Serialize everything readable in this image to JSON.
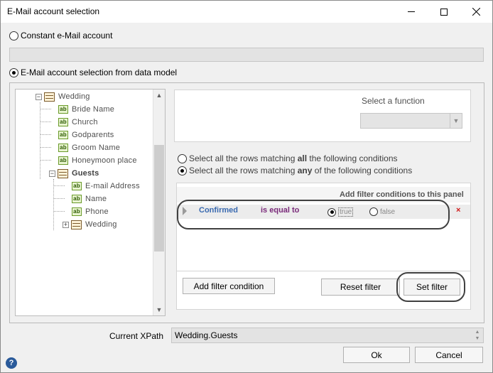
{
  "window": {
    "title": "E-Mail account selection"
  },
  "options": {
    "constant_label": "Constant e-Mail account",
    "constant_checked": false,
    "from_model_label": "E-Mail account selection from data model",
    "from_model_checked": true
  },
  "tree": {
    "items": [
      {
        "label": "Wedding",
        "kind": "table",
        "icon": "table-icon",
        "expander": "minus"
      },
      {
        "label": "Bride Name",
        "kind": "field",
        "icon": "ab-field-icon"
      },
      {
        "label": "Church",
        "kind": "field",
        "icon": "ab-field-icon"
      },
      {
        "label": "Godparents",
        "kind": "field",
        "icon": "ab-field-icon"
      },
      {
        "label": "Groom Name",
        "kind": "field",
        "icon": "ab-field-icon"
      },
      {
        "label": "Honeymoon place",
        "kind": "field",
        "icon": "ab-field-icon"
      },
      {
        "label": "Guests",
        "kind": "table",
        "icon": "table-icon",
        "expander": "minus",
        "bold": true
      },
      {
        "label": "E-mail Address",
        "kind": "field",
        "icon": "ab-field-icon"
      },
      {
        "label": "Name",
        "kind": "field",
        "icon": "ab-field-icon"
      },
      {
        "label": "Phone",
        "kind": "field",
        "icon": "ab-field-icon"
      },
      {
        "label": "Wedding",
        "kind": "table",
        "icon": "table-icon",
        "expander": "plus"
      }
    ]
  },
  "function": {
    "label": "Select a function",
    "value": ""
  },
  "match": {
    "all_pre": "Select all the rows matching ",
    "all_bold": "all",
    "all_post": " the following conditions",
    "all_checked": false,
    "any_pre": "Select all the rows matching ",
    "any_bold": "any",
    "any_post": " of the following conditions",
    "any_checked": true
  },
  "filter": {
    "header": "Add filter conditions to this panel",
    "condition": {
      "field": "Confirmed",
      "operator": "is equal to",
      "true_label": "true",
      "false_label": "false",
      "selected": "true",
      "delete": "×"
    }
  },
  "buttons": {
    "add_condition": "Add filter condition",
    "reset_filter": "Reset  filter",
    "set_filter": "Set  filter",
    "ok": "Ok",
    "cancel": "Cancel"
  },
  "xpath": {
    "label": "Current XPath",
    "value": "Wedding.Guests"
  },
  "help": {
    "glyph": "?"
  },
  "colors": {
    "field_blue": "#3a6ab0",
    "operator_purple": "#7a2a7a",
    "delete_red": "#d01818"
  }
}
